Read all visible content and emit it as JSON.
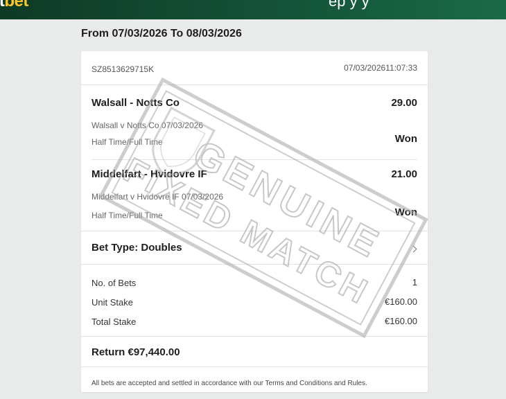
{
  "header": {
    "logo_main": "et",
    "logo_accent": "bet",
    "right_text": "ep      y      y"
  },
  "date_range": "From 07/03/2026 To 08/03/2026",
  "bet": {
    "reference": "SZ8513629715K",
    "placed_at": "07/03/202611:07:33",
    "selections": [
      {
        "name": "Walsall - Notts Co",
        "odds": "29.00",
        "event": "Walsall v Notts Co 07/03/2026",
        "market": "Half Time/Full Time",
        "result": "Won"
      },
      {
        "name": "Middelfart - Hvidovre IF",
        "odds": "21.00",
        "event": "Middelfart v Hvidovre IF 07/03/2026",
        "market": "Half Time/Full Time",
        "result": "Won"
      }
    ],
    "bet_type": "Bet Type: Doubles",
    "summary": [
      {
        "label": "No. of Bets",
        "value": "1"
      },
      {
        "label": "Unit Stake",
        "value": "€160.00"
      },
      {
        "label": "Total Stake",
        "value": "€160.00"
      }
    ],
    "return": "Return €97,440.00",
    "terms": "All bets are accepted and settled in accordance with our Terms and Conditions and Rules."
  },
  "watermark": {
    "line1": "GENUINE",
    "line2": "FIXED MATCH"
  },
  "colors": {
    "header_bg": "#14553a",
    "brand_accent": "#ffc629",
    "page_bg": "#e9eaea",
    "watermark": "#9a9a9a"
  }
}
